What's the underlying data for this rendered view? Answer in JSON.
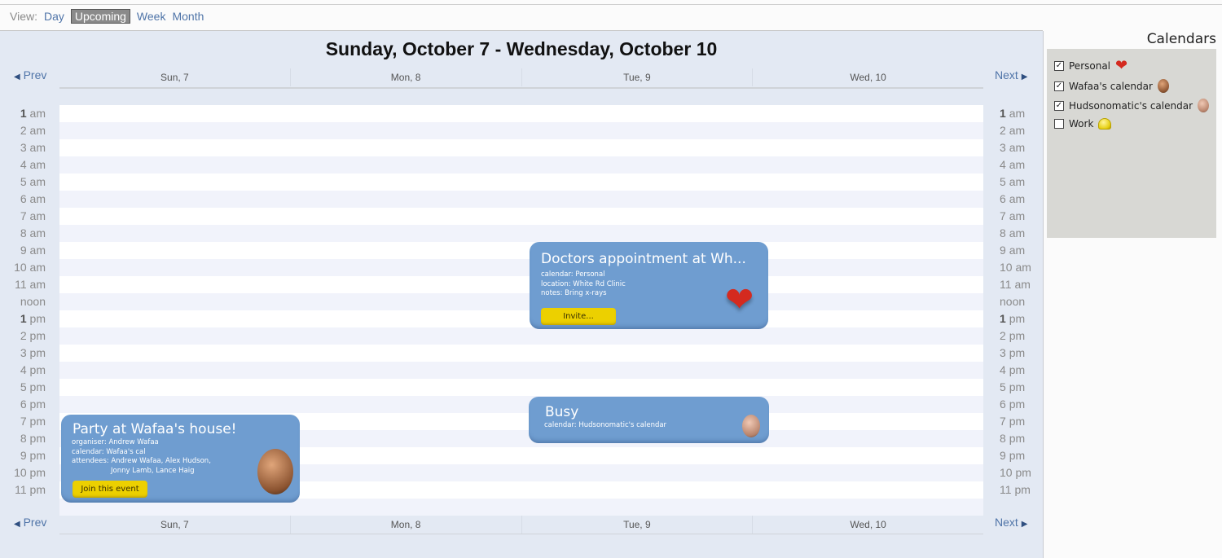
{
  "view_bar": {
    "label": "View:",
    "options": [
      {
        "label": "Day",
        "active": false
      },
      {
        "label": "Upcoming",
        "active": true
      },
      {
        "label": "Week",
        "active": false
      },
      {
        "label": "Month",
        "active": false
      }
    ]
  },
  "main": {
    "title": "Sunday, October 7 - Wednesday, October 10",
    "prev_label": "Prev",
    "next_label": "Next",
    "days": [
      "Sun, 7",
      "Mon, 8",
      "Tue, 9",
      "Wed, 10"
    ],
    "hours": [
      {
        "num": "1",
        "suffix": "am"
      },
      {
        "num": "2",
        "suffix": "am"
      },
      {
        "num": "3",
        "suffix": "am"
      },
      {
        "num": "4",
        "suffix": "am"
      },
      {
        "num": "5",
        "suffix": "am"
      },
      {
        "num": "6",
        "suffix": "am"
      },
      {
        "num": "7",
        "suffix": "am"
      },
      {
        "num": "8",
        "suffix": "am"
      },
      {
        "num": "9",
        "suffix": "am"
      },
      {
        "num": "10",
        "suffix": "am"
      },
      {
        "num": "11",
        "suffix": "am"
      },
      {
        "num": "",
        "suffix": "noon"
      },
      {
        "num": "1",
        "suffix": "pm"
      },
      {
        "num": "2",
        "suffix": "pm"
      },
      {
        "num": "3",
        "suffix": "pm"
      },
      {
        "num": "4",
        "suffix": "pm"
      },
      {
        "num": "5",
        "suffix": "pm"
      },
      {
        "num": "6",
        "suffix": "pm"
      },
      {
        "num": "7",
        "suffix": "pm"
      },
      {
        "num": "8",
        "suffix": "pm"
      },
      {
        "num": "9",
        "suffix": "pm"
      },
      {
        "num": "10",
        "suffix": "pm"
      },
      {
        "num": "11",
        "suffix": "pm"
      }
    ]
  },
  "events": {
    "doctors": {
      "title": "Doctors appointment at Wh...",
      "calendar": "calendar: Personal",
      "location": "location: White Rd Clinic",
      "notes": "notes: Bring x-rays",
      "button": "Invite...",
      "icon": "heart-icon"
    },
    "busy": {
      "title": "Busy",
      "calendar": "calendar: Hudsonomatic's calendar",
      "icon": "hudsonomatic-avatar"
    },
    "party": {
      "title": "Party at Wafaa's house!",
      "organiser": "organiser: Andrew Wafaa",
      "calendar": "calendar: Wafaa's cal",
      "attendees_1": "attendees: Andrew Wafaa, Alex Hudson,",
      "attendees_2": "Jonny Lamb, Lance Haig",
      "button": "Join this event",
      "icon": "wafaa-avatar"
    }
  },
  "sidebar": {
    "title": "Calendars",
    "calendars": [
      {
        "label": "Personal",
        "checked": true,
        "icon": "heart-icon"
      },
      {
        "label": "Wafaa's calendar",
        "checked": true,
        "icon": "wafaa-avatar"
      },
      {
        "label": "Hudsonomatic's calendar",
        "checked": true,
        "icon": "hudsonomatic-avatar"
      },
      {
        "label": "Work",
        "checked": false,
        "icon": "helmet-icon"
      }
    ]
  },
  "colors": {
    "event_bg": "#6f9dd0",
    "button_yellow": "#ecd000",
    "link": "#4f74a8",
    "main_bg": "#e3e9f3",
    "sidebar_bg": "#d8d8d4"
  }
}
